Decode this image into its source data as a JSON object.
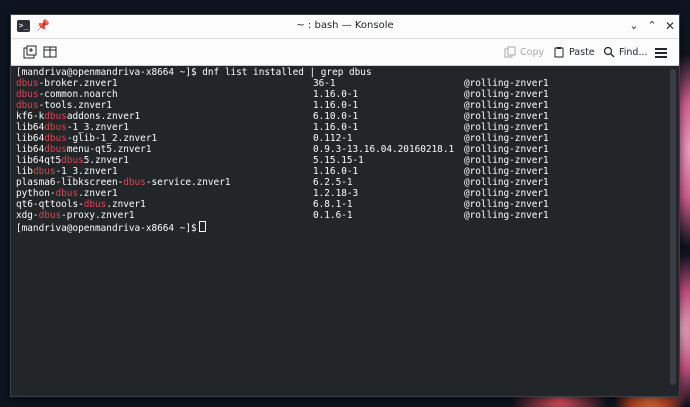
{
  "window": {
    "title": "~ : bash — Konsole"
  },
  "toolbar": {
    "copy_label": "Copy",
    "paste_label": "Paste",
    "find_label": "Find..."
  },
  "colors": {
    "highlight": "#da4453",
    "terminal_bg": "#232629",
    "terminal_fg": "#fcfcfc"
  },
  "terminal": {
    "prompt_command": "[mandriva@openmandriva-x8664 ~]$ dnf list installed | grep dbus",
    "rows": [
      {
        "pre": "",
        "match": "dbus",
        "post": "-broker.znver1",
        "version": "36-1",
        "repo": "@rolling-znver1"
      },
      {
        "pre": "",
        "match": "dbus",
        "post": "-common.noarch",
        "version": "1.16.0-1",
        "repo": "@rolling-znver1"
      },
      {
        "pre": "",
        "match": "dbus",
        "post": "-tools.znver1",
        "version": "1.16.0-1",
        "repo": "@rolling-znver1"
      },
      {
        "pre": "kf6-k",
        "match": "dbus",
        "post": "addons.znver1",
        "version": "6.10.0-1",
        "repo": "@rolling-znver1"
      },
      {
        "pre": "lib64",
        "match": "dbus",
        "post": "-1_3.znver1",
        "version": "1.16.0-1",
        "repo": "@rolling-znver1"
      },
      {
        "pre": "lib64",
        "match": "dbus",
        "post": "-glib-1_2.znver1",
        "version": "0.112-1",
        "repo": "@rolling-znver1"
      },
      {
        "pre": "lib64",
        "match": "dbus",
        "post": "menu-qt5.znver1",
        "version": "0.9.3-13.16.04.20160218.1",
        "repo": "@rolling-znver1"
      },
      {
        "pre": "lib64qt5",
        "match": "dbus",
        "post": "5.znver1",
        "version": "5.15.15-1",
        "repo": "@rolling-znver1"
      },
      {
        "pre": "lib",
        "match": "dbus",
        "post": "-1_3.znver1",
        "version": "1.16.0-1",
        "repo": "@rolling-znver1"
      },
      {
        "pre": "plasma6-libkscreen-",
        "match": "dbus",
        "post": "-service.znver1",
        "version": "6.2.5-1",
        "repo": "@rolling-znver1"
      },
      {
        "pre": "python-",
        "match": "dbus",
        "post": ".znver1",
        "version": "1.2.18-3",
        "repo": "@rolling-znver1"
      },
      {
        "pre": "qt6-qttools-",
        "match": "dbus",
        "post": ".znver1",
        "version": "6.8.1-1",
        "repo": "@rolling-znver1"
      },
      {
        "pre": "xdg-",
        "match": "dbus",
        "post": "-proxy.znver1",
        "version": "0.1.6-1",
        "repo": "@rolling-znver1"
      }
    ],
    "final_prompt": "[mandriva@openmandriva-x8664 ~]$"
  }
}
